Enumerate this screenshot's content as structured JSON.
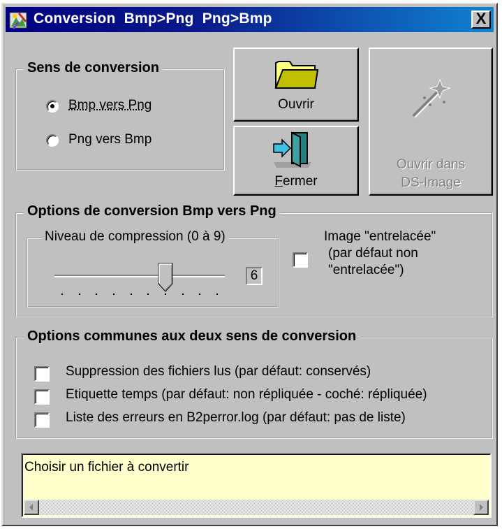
{
  "window": {
    "title": "Conversion  Bmp>Png  Png>Bmp",
    "close_label": "X"
  },
  "direction_group": {
    "legend": "Sens de conversion",
    "options": [
      {
        "label": "Bmp vers Png",
        "selected": true
      },
      {
        "label": "Png vers Bmp",
        "selected": false
      }
    ]
  },
  "buttons": {
    "open": "Ouvrir",
    "close_first": "F",
    "close_rest": "ermer",
    "open_ds_line1": "Ouvrir dans",
    "open_ds_line2": "DS-Image"
  },
  "bmp_png_group": {
    "legend": "Options de conversion Bmp vers Png",
    "compression_legend": "Niveau de compression (0 à 9)",
    "compression_value": "6",
    "compression_level": 6,
    "compression_max": 9,
    "interlace_line1": "Image \"entrelacée\"",
    "interlace_line2": "(par défaut non",
    "interlace_line3": "\"entrelacée\")",
    "interlace_checked": false
  },
  "common_group": {
    "legend": "Options communes aux deux sens de conversion",
    "options": [
      {
        "label": "Suppression des fichiers lus (par défaut: conservés)",
        "checked": false
      },
      {
        "label": "Etiquette temps (par défaut: non répliquée - coché: répliquée)",
        "checked": false
      },
      {
        "label": "Liste des erreurs en B2perror.log (par défaut: pas de liste)",
        "checked": false
      }
    ]
  },
  "status": {
    "message": "Choisir un fichier à convertir"
  },
  "colors": {
    "face": "#c0c0c0",
    "title_start": "#000080",
    "title_end": "#1084d0",
    "status_bg": "#ffffcc"
  }
}
